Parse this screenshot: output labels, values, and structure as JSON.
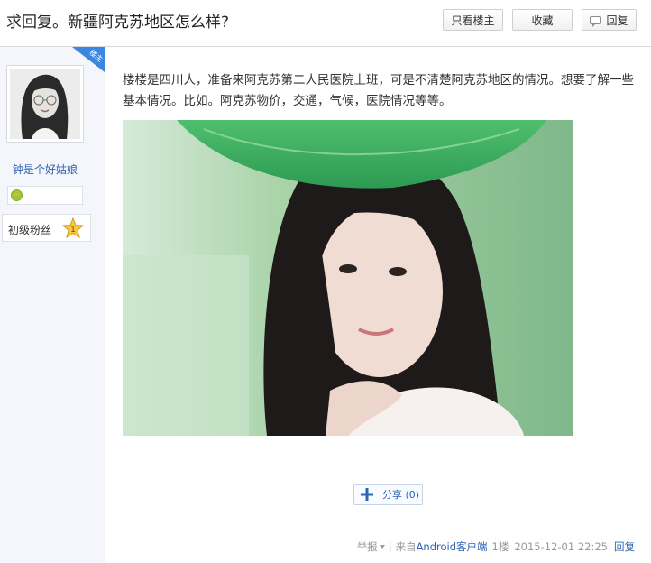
{
  "header": {
    "title": "求回复。新疆阿克苏地区怎么样?",
    "buttons": {
      "only_op": "只看楼主",
      "favorite": "收藏",
      "reply": "回复"
    }
  },
  "author": {
    "tag": "楼主",
    "username": "钟是个好姑娘",
    "level_title": "初级粉丝",
    "level": "1"
  },
  "post": {
    "text": "楼楼是四川人，准备来阿克苏第二人民医院上班，可是不清楚阿克苏地区的情况。想要了解一些基本情况。比如。阿克苏物价，交通，气候，医院情况等等。",
    "share_label": "分享 (0)"
  },
  "footer": {
    "report": "举报",
    "separator": "|",
    "source_prefix": "来自",
    "source_link": "Android客户端",
    "floor": "1楼",
    "timestamp": "2015-12-01 22:25",
    "reply": "回复"
  },
  "colors": {
    "link": "#2d64b3",
    "tag": "#3b86e0",
    "sidebar": "#f4f6fb"
  },
  "icons": {
    "reply": "speech-bubble-icon",
    "share": "plus-icon",
    "badge": "frog-icon",
    "level": "star-icon",
    "report_menu": "caret-down-icon"
  }
}
